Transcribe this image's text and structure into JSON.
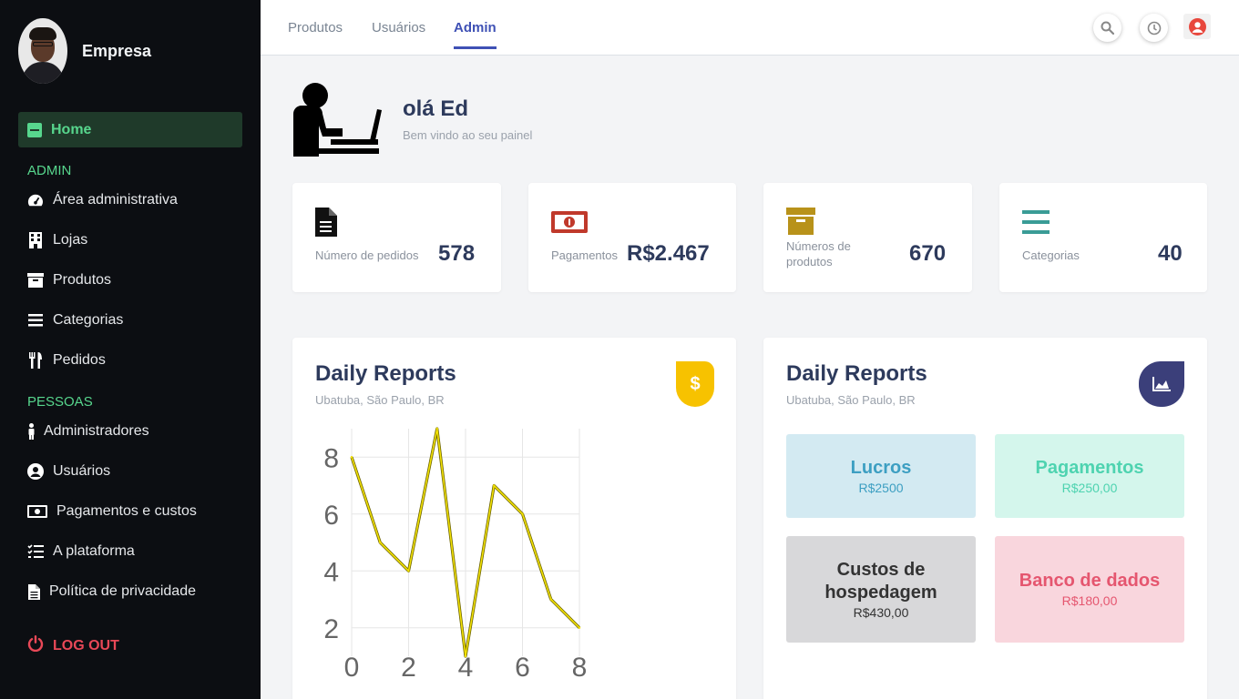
{
  "sidebar": {
    "company": "Empresa",
    "home": "Home",
    "section_admin": "ADMIN",
    "admin_items": [
      {
        "label": "Área administrativa",
        "icon": "dashboard-icon"
      },
      {
        "label": "Lojas",
        "icon": "building-icon"
      },
      {
        "label": "Produtos",
        "icon": "archive-icon"
      },
      {
        "label": "Categorias",
        "icon": "list-icon"
      },
      {
        "label": "Pedidos",
        "icon": "utensils-icon"
      }
    ],
    "section_people": "PESSOAS",
    "people_items": [
      {
        "label": "Administradores",
        "icon": "person-icon"
      },
      {
        "label": "Usuários",
        "icon": "user-circle-icon"
      },
      {
        "label": "Pagamentos e custos",
        "icon": "money-icon"
      },
      {
        "label": "A plataforma",
        "icon": "tasks-icon"
      },
      {
        "label": "Política de privacidade",
        "icon": "file-icon"
      }
    ],
    "logout": "LOG OUT"
  },
  "header": {
    "tabs": [
      "Produtos",
      "Usuários",
      "Admin"
    ],
    "active_tab": "Admin"
  },
  "greeting": {
    "title": "olá Ed",
    "subtitle": "Bem vindo ao seu painel"
  },
  "stats": [
    {
      "label": "Número de pedidos",
      "value": "578",
      "icon": "document-icon",
      "color": "#111111"
    },
    {
      "label": "Pagamentos",
      "value": "R$2.467",
      "icon": "money-bill-icon",
      "color": "#c0392b"
    },
    {
      "label": "Números de produtos",
      "value": "670",
      "icon": "box-icon",
      "color": "#b8921a"
    },
    {
      "label": "Categorias",
      "value": "40",
      "icon": "bars-icon",
      "color": "#3a9c96"
    }
  ],
  "reports": [
    {
      "title": "Daily Reports",
      "location": "Ubatuba, São Paulo, BR",
      "badge_icon": "dollar-icon",
      "badge_color": "#f7c200"
    },
    {
      "title": "Daily Reports",
      "location": "Ubatuba, São Paulo, BR",
      "badge_icon": "area-chart-icon",
      "badge_color": "#3b3f7a"
    }
  ],
  "chart_data": {
    "type": "line",
    "x": [
      0,
      1,
      2,
      3,
      4,
      5,
      6,
      7,
      8
    ],
    "y": [
      8,
      5,
      4,
      9,
      1,
      7,
      6,
      3,
      2
    ],
    "x_ticks": [
      "0",
      "2",
      "4",
      "6",
      "8"
    ],
    "y_ticks": [
      "2",
      "4",
      "6",
      "8"
    ],
    "xlim": [
      0,
      8
    ],
    "ylim": [
      1,
      9
    ],
    "grid": true,
    "line_color": "#f2e100"
  },
  "tiles": [
    {
      "name": "Lucros",
      "value": "R$2500",
      "bg": "#d3eaf2",
      "fg": "#3d9fc2"
    },
    {
      "name": "Pagamentos",
      "value": "R$250,00",
      "bg": "#d4f6ec",
      "fg": "#4ed3b0"
    },
    {
      "name": "Custos de hospedagem",
      "value": "R$430,00",
      "bg": "#d8d8da",
      "fg": "#333333"
    },
    {
      "name": "Banco de dados",
      "value": "R$180,00",
      "bg": "#f9d6dd",
      "fg": "#e5566f"
    }
  ]
}
